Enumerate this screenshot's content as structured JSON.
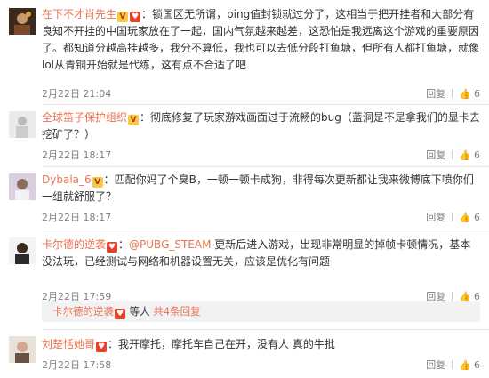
{
  "comments": [
    {
      "name": "在下不才肖先生",
      "text": "：锁国区无所谓，ping值封锁就过分了，这相当于把开挂者和大部分有良知不开挂的中国玩家放在了一起，国内气氛越来越差，这恐怕是我远离这个游戏的重要原因了。都知道分越高挂越多，我分不算低，我也可以去低分段打鱼塘，但所有人都打鱼塘，就像lol从青铜开始就是代练，这有点不合适了吧",
      "time": "2月22日 21:04",
      "reply": "回复",
      "likes": "6"
    },
    {
      "name": "全球笛子保护组织",
      "text": "：彻底修复了玩家游戏画面过于流畅的bug（蓝洞是不是拿我们的显卡去挖矿了？）",
      "time": "2月22日 18:17",
      "reply": "回复",
      "likes": "6"
    },
    {
      "name": "Dybala_6",
      "text": "：匹配你妈了个臭B，一顿一顿卡成狗，非得每次更新都让我来微博底下喷你们一组就舒服了？",
      "time": "2月22日 18:17",
      "reply": "回复",
      "likes": "6"
    },
    {
      "name": "卡尔德的逆袭",
      "mention": "@PUBG_STEAM",
      "text": " 更新后进入游戏，出现非常明显的掉帧卡顿情况，基本没法玩，已经测试与网络和机器设置无关，应该是优化有问题",
      "time": "2月22日 17:59",
      "reply": "回复",
      "likes": "6"
    },
    {
      "name": "刘楚恬她哥",
      "text": "：我开摩托，摩托车自己在开，没有人 真的牛批",
      "time": "2月22日 17:58",
      "reply": "回复",
      "likes": "6"
    }
  ],
  "sub_replies": {
    "name": "卡尔德的逆袭",
    "suffix": "等人",
    "count": "共4条回复"
  },
  "colors": {
    "accent": "#eb7350",
    "text": "#333333",
    "meta": "#808080"
  }
}
